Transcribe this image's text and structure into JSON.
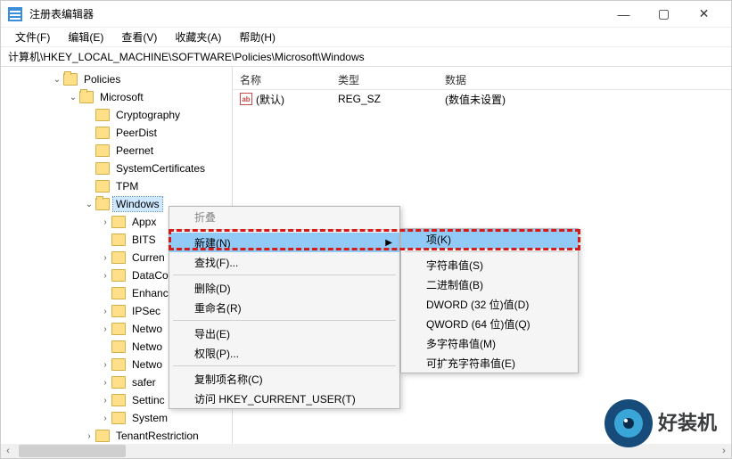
{
  "titlebar": {
    "title": "注册表编辑器"
  },
  "menubar": [
    "文件(F)",
    "编辑(E)",
    "查看(V)",
    "收藏夹(A)",
    "帮助(H)"
  ],
  "address": "计算机\\HKEY_LOCAL_MACHINE\\SOFTWARE\\Policies\\Microsoft\\Windows",
  "tree": {
    "root": {
      "label": "Policies",
      "expanded": true
    },
    "microsoft": {
      "label": "Microsoft",
      "expanded": true
    },
    "children": [
      "Cryptography",
      "PeerDist",
      "Peernet",
      "SystemCertificates",
      "TPM"
    ],
    "windows": {
      "label": "Windows",
      "expanded": true,
      "selected": true
    },
    "winChildren": [
      "Appx",
      "BITS",
      "Curren",
      "DataCo",
      "Enhanc",
      "IPSec",
      "Netwo",
      "Netwo",
      "Netwo",
      "safer",
      "Settinc",
      "System"
    ],
    "tenant": "TenantRestriction"
  },
  "columns": {
    "name": "名称",
    "type": "类型",
    "data": "数据"
  },
  "rows": [
    {
      "name": "(默认)",
      "type": "REG_SZ",
      "data": "(数值未设置)"
    }
  ],
  "ctx1": {
    "collapse": "折叠",
    "new": "新建(N)",
    "find": "查找(F)...",
    "delete": "删除(D)",
    "rename": "重命名(R)",
    "export": "导出(E)",
    "perm": "权限(P)...",
    "copyKey": "复制项名称(C)",
    "goto": "访问 HKEY_CURRENT_USER(T)"
  },
  "ctx2": {
    "key": "项(K)",
    "string": "字符串值(S)",
    "binary": "二进制值(B)",
    "dword": "DWORD (32 位)值(D)",
    "qword": "QWORD (64 位)值(Q)",
    "multi": "多字符串值(M)",
    "expand": "可扩充字符串值(E)"
  },
  "logo": "好装机"
}
